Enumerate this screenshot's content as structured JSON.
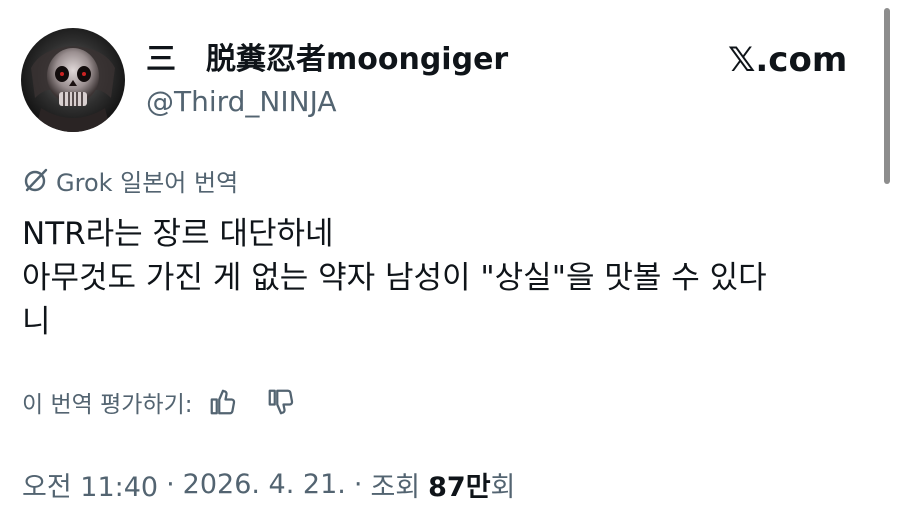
{
  "author": {
    "display_name": "三　脱糞忍者moongiger",
    "handle": "@Third_NINJA"
  },
  "brand": "𝕏.com",
  "translation": {
    "label": "Grok 일본어 번역"
  },
  "tweet": {
    "lines": [
      "NTR라는 장르 대단하네",
      "아무것도 가진 게 없는 약자 남성이 \"상실\"을 맛볼 수 있다",
      "니"
    ]
  },
  "rating": {
    "label": "이 번역 평가하기:"
  },
  "meta": {
    "time": "오전 11:40",
    "date": "2026. 4. 21.",
    "views_prefix": "조회",
    "views_count": "87만",
    "views_suffix": "회",
    "separator": "·"
  },
  "colors": {
    "text_primary": "#0f1419",
    "text_secondary": "#536471",
    "background": "#ffffff"
  },
  "icons": {
    "translate": "grok-icon",
    "thumbs_up": "thumbs-up-icon",
    "thumbs_down": "thumbs-down-icon"
  }
}
